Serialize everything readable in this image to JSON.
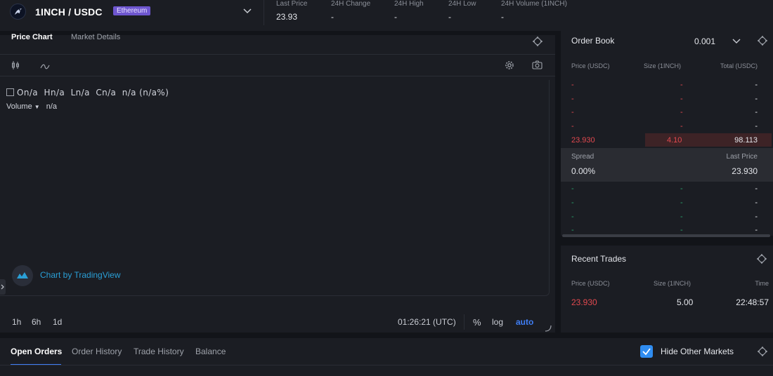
{
  "header": {
    "pair": "1INCH / USDC",
    "chain_badge": "Ethereum",
    "stats": [
      {
        "label": "Last Price",
        "value": "23.93"
      },
      {
        "label": "24H Change",
        "value": "-"
      },
      {
        "label": "24H High",
        "value": "-"
      },
      {
        "label": "24H Low",
        "value": "-"
      },
      {
        "label": "24H Volume (1INCH)",
        "value": "-"
      }
    ]
  },
  "chart_panel": {
    "tabs": [
      "Price Chart",
      "Market Details"
    ],
    "ohlc": {
      "o": "O",
      "o_val": "n/a",
      "h": "H",
      "h_val": "n/a",
      "l": "L",
      "l_val": "n/a",
      "c": "C",
      "c_val": "n/a",
      "change": "n/a (n/a%)"
    },
    "volume_label": "Volume",
    "volume_value": "n/a",
    "attribution": "Chart by TradingView",
    "timeframes": [
      "1h",
      "6h",
      "1d"
    ],
    "clock": "01:26:21 (UTC)",
    "scale_options": [
      "%",
      "log",
      "auto"
    ]
  },
  "order_book": {
    "title": "Order Book",
    "precision": "0.001",
    "columns": [
      "Price (USDC)",
      "Size (1INCH)",
      "Total (USDC)"
    ],
    "asks": [
      {
        "price": "-",
        "size": "-",
        "total": "-"
      },
      {
        "price": "-",
        "size": "-",
        "total": "-"
      },
      {
        "price": "-",
        "size": "-",
        "total": "-"
      },
      {
        "price": "-",
        "size": "-",
        "total": "-"
      },
      {
        "price": "23.930",
        "size": "4.10",
        "total": "98.113"
      }
    ],
    "spread_label": "Spread",
    "spread_value": "0.00%",
    "last_price_label": "Last Price",
    "last_price_value": "23.930",
    "bids": [
      {
        "price": "-",
        "size": "-",
        "total": "-"
      },
      {
        "price": "-",
        "size": "-",
        "total": "-"
      },
      {
        "price": "-",
        "size": "-",
        "total": "-"
      },
      {
        "price": "-",
        "size": "-",
        "total": "-"
      }
    ]
  },
  "recent_trades": {
    "title": "Recent Trades",
    "columns": [
      "Price (USDC)",
      "Size (1INCH)",
      "Time"
    ],
    "rows": [
      {
        "price": "23.930",
        "size": "5.00",
        "time": "22:48:57"
      }
    ]
  },
  "orders": {
    "tabs": [
      "Open Orders",
      "Order History",
      "Trade History",
      "Balance"
    ],
    "hide_other_markets_label": "Hide Other Markets",
    "hide_other_markets_checked": true
  },
  "colors": {
    "accent": "#3f7ef5",
    "ask": "#e2494f",
    "bid": "#28a26b",
    "badge": "#6e56cf"
  }
}
